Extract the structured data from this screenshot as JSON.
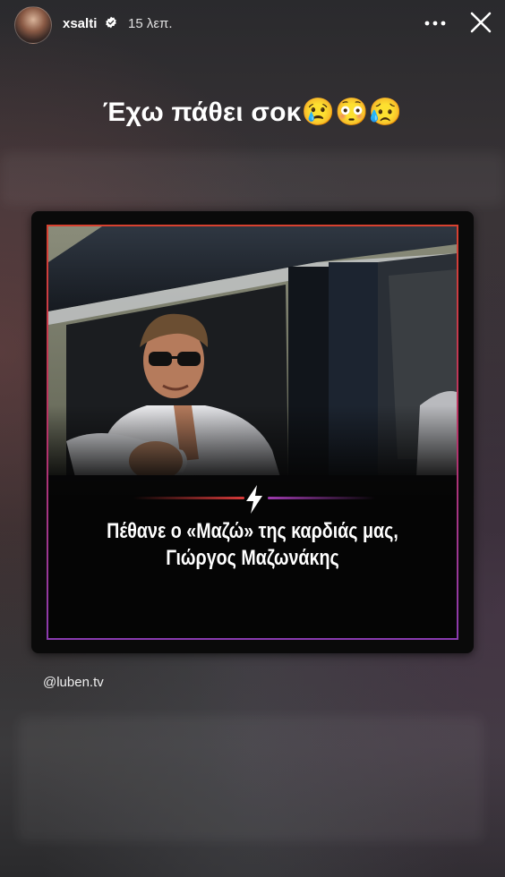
{
  "header": {
    "username": "xsalti",
    "verified": true,
    "time_ago": "15 λεπ.",
    "more_icon": "more-horizontal-icon",
    "close_icon": "close-icon"
  },
  "story": {
    "caption": "Έχω πάθει σοκ😢😳😥",
    "mention": "@luben.tv"
  },
  "post": {
    "headline_line1": "Πέθανε ο «Μαζώ» της καρδιάς μας,",
    "headline_line2": "Γιώργος Μαζωνάκης",
    "accent_colors": [
      "#d83a3a",
      "#9f3bb0"
    ]
  }
}
